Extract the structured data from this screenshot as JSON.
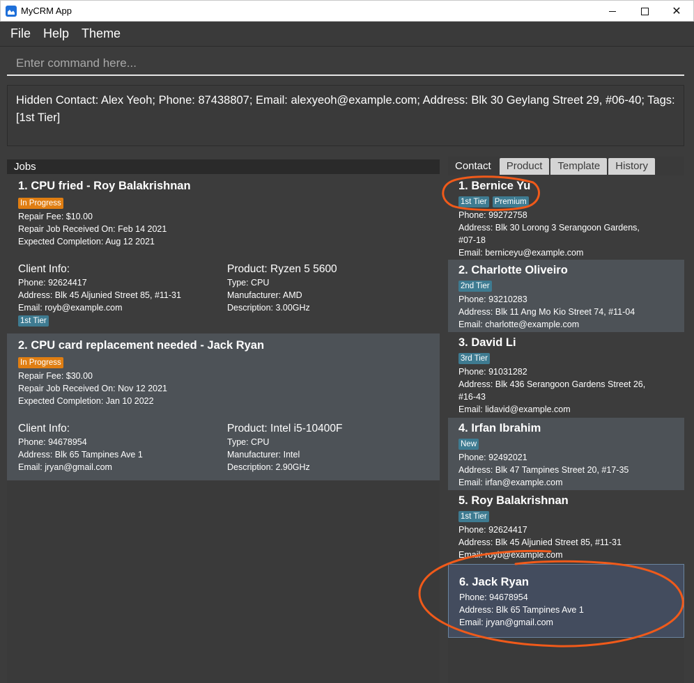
{
  "window": {
    "title": "MyCRM App"
  },
  "menu": [
    "File",
    "Help",
    "Theme"
  ],
  "command": {
    "placeholder": "Enter command here..."
  },
  "result": {
    "text": "Hidden Contact: Alex Yeoh; Phone: 87438807; Email: alexyeoh@example.com; Address: Blk 30 Geylang Street 29, #06-40; Tags: [1st Tier]"
  },
  "jobs": {
    "header": "Jobs",
    "items": [
      {
        "title": "1. CPU fried - Roy Balakrishnan",
        "status": "In Progress",
        "fee": "Repair Fee: $10.00",
        "received": "Repair Job Received On: Feb 14 2021",
        "expected": "Expected Completion: Aug 12 2021",
        "client_title": "Client Info:",
        "client_phone": "Phone: 92624417",
        "client_address": "Address: Blk 45 Aljunied Street 85, #11-31",
        "client_email": "Email: royb@example.com",
        "client_tag": "1st Tier",
        "product_title": "Product: Ryzen 5 5600",
        "product_type": "Type: CPU",
        "product_manufacturer": "Manufacturer: AMD",
        "product_description": "Description: 3.00GHz"
      },
      {
        "title": "2. CPU card replacement needed - Jack Ryan",
        "status": "In Progress",
        "fee": "Repair Fee: $30.00",
        "received": "Repair Job Received On: Nov 12 2021",
        "expected": "Expected Completion: Jan 10 2022",
        "client_title": "Client Info:",
        "client_phone": "Phone: 94678954",
        "client_address": "Address: Blk 65 Tampines Ave 1",
        "client_email": "Email: jryan@gmail.com",
        "product_title": "Product: Intel i5-10400F",
        "product_type": "Type: CPU",
        "product_manufacturer": "Manufacturer: Intel",
        "product_description": "Description: 2.90GHz"
      }
    ]
  },
  "tabs": [
    "Contact",
    "Product",
    "Template",
    "History"
  ],
  "contacts": [
    {
      "name": "1.  Bernice Yu",
      "tags": [
        "1st Tier",
        "Premium"
      ],
      "phone": "Phone: 99272758",
      "address": "Address: Blk 30 Lorong 3 Serangoon Gardens,",
      "address2": "#07-18",
      "email": "Email: berniceyu@example.com"
    },
    {
      "name": "2.  Charlotte Oliveiro",
      "tags": [
        "2nd Tier"
      ],
      "phone": "Phone: 93210283",
      "address": "Address: Blk 11 Ang Mo Kio Street 74, #11-04",
      "email": "Email: charlotte@example.com"
    },
    {
      "name": "3.  David Li",
      "tags": [
        "3rd Tier"
      ],
      "phone": "Phone: 91031282",
      "address": "Address: Blk 436 Serangoon Gardens Street 26,",
      "address2": "#16-43",
      "email": "Email: lidavid@example.com"
    },
    {
      "name": "4.  Irfan Ibrahim",
      "tags": [
        "New"
      ],
      "phone": "Phone: 92492021",
      "address": "Address: Blk 47 Tampines Street 20, #17-35",
      "email": "Email: irfan@example.com"
    },
    {
      "name": "5.  Roy Balakrishnan",
      "tags": [
        "1st Tier"
      ],
      "phone": "Phone: 92624417",
      "address": "Address: Blk 45 Aljunied Street 85, #11-31",
      "email": "Email: royb@example.com"
    },
    {
      "name": "6.  Jack Ryan",
      "phone": "Phone: 94678954",
      "address": "Address: Blk 65 Tampines Ave 1",
      "email": "Email: jryan@gmail.com"
    }
  ],
  "colors": {
    "accent_orange": "#e07e12",
    "tag_blue": "#3e7b91",
    "annotation": "#f05a1a"
  }
}
